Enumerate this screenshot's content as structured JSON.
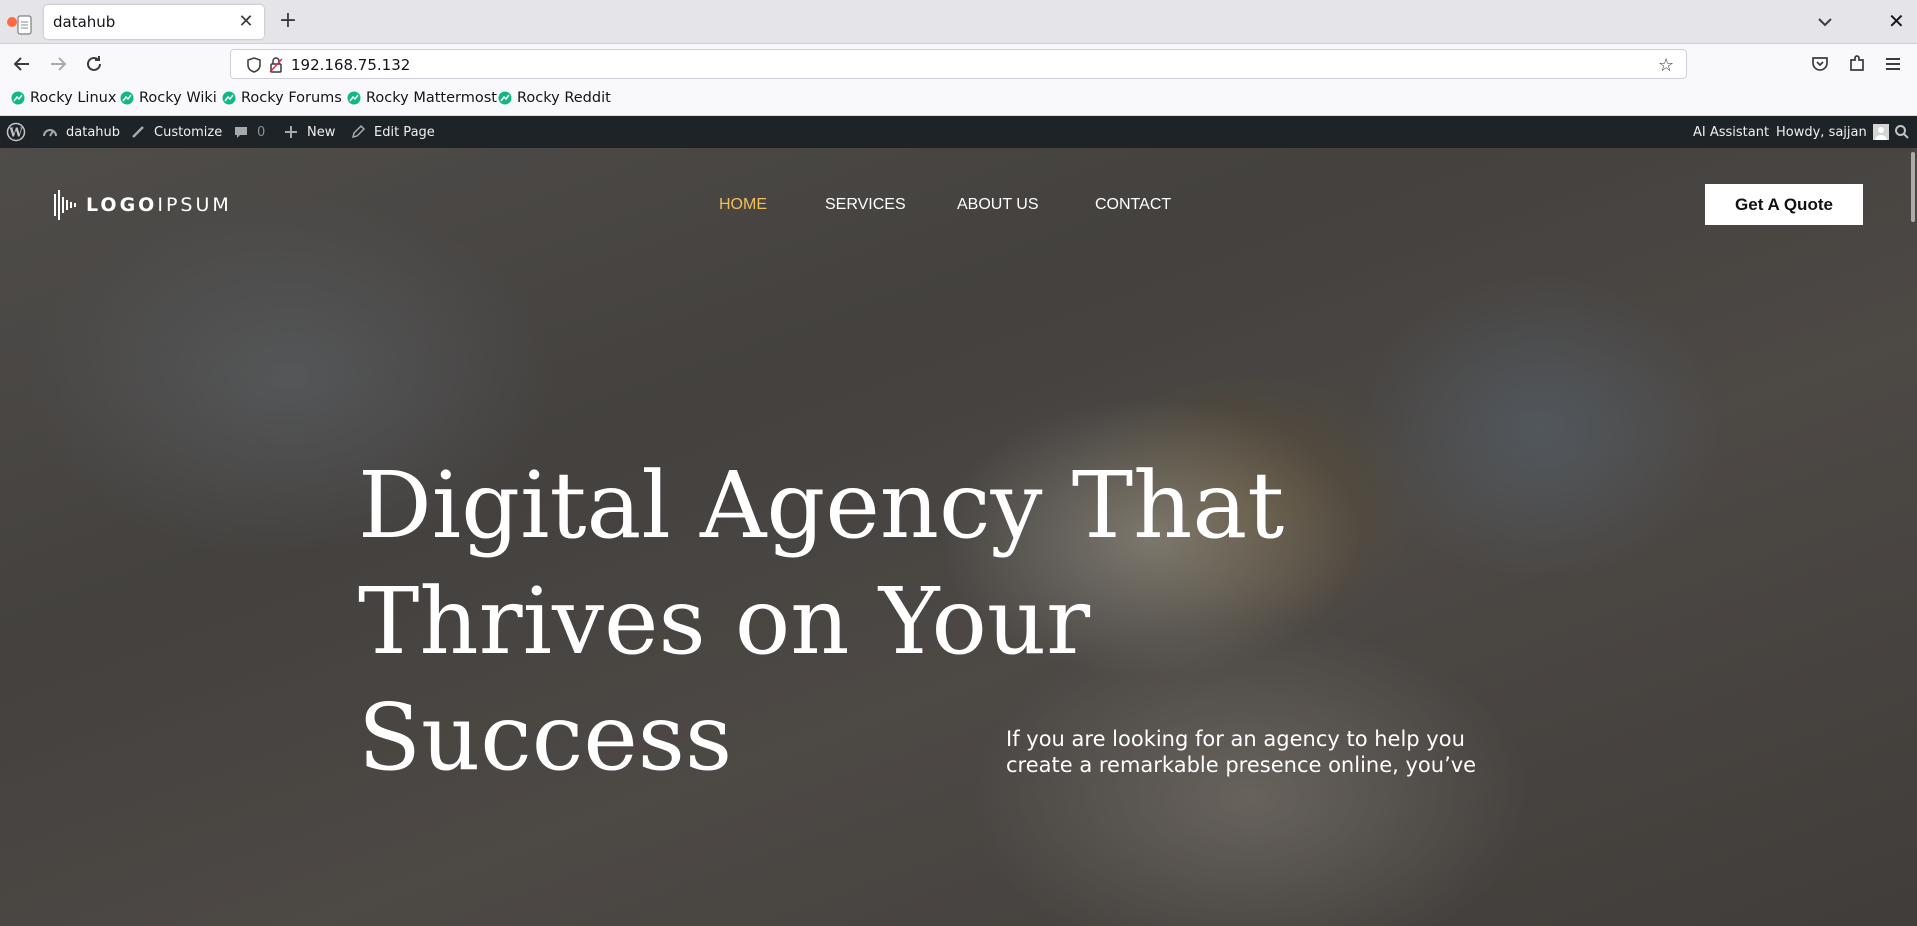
{
  "browser": {
    "tab_title": "datahub",
    "tab_close": "✕",
    "new_tab": "+",
    "url": "192.168.75.132",
    "bookmarks": [
      "Rocky Linux",
      "Rocky Wiki",
      "Rocky Forums",
      "Rocky Mattermost",
      "Rocky Reddit"
    ]
  },
  "admin_bar": {
    "site_name": "datahub",
    "customize": "Customize",
    "comments_count": "0",
    "new": "New",
    "edit_page": "Edit Page",
    "ai_assistant": "AI Assistant",
    "howdy": "Howdy, sajjan"
  },
  "site": {
    "logo": {
      "part1": "LOGO",
      "part2": "IPSUM"
    },
    "menu": [
      "HOME",
      "SERVICES",
      "ABOUT US",
      "CONTACT"
    ],
    "active_menu": "HOME",
    "cta": "Get A Quote",
    "headline_lines": [
      "Digital Agency That",
      "Thrives on Your",
      "Success"
    ],
    "subtext": "If you are looking for an agency to help you create a remarkable presence online, you’ve"
  },
  "colors": {
    "admin_bar_bg": "#1d2327",
    "menu_active": "#f0c05a",
    "bookmark_icon": "#10b981"
  }
}
